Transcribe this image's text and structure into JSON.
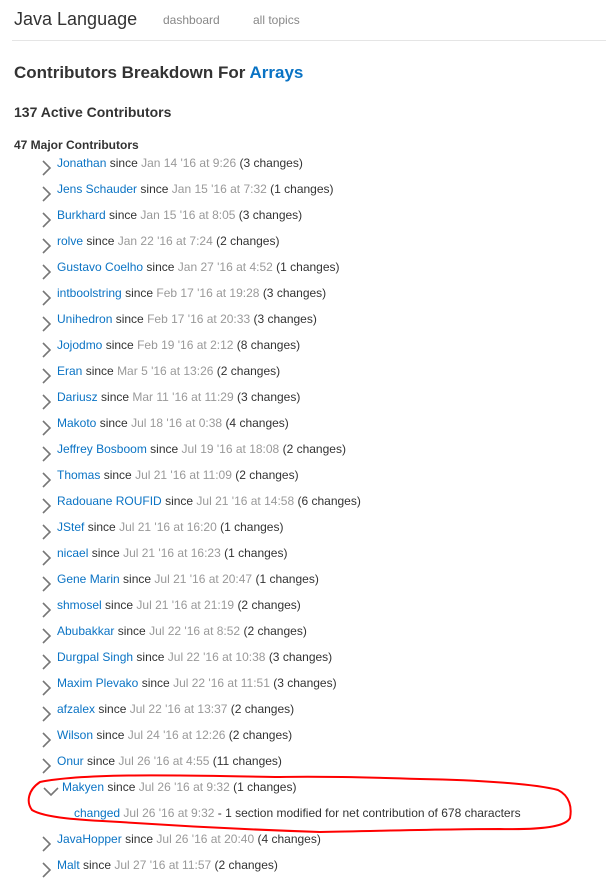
{
  "header": {
    "brand": "Java Language",
    "nav": [
      {
        "label": "dashboard"
      },
      {
        "label": "all topics"
      }
    ]
  },
  "page": {
    "title_prefix": "Contributors Breakdown For",
    "topic": "Arrays",
    "active_contributors": "137 Active Contributors",
    "major_contributors": "47 Major Contributors"
  },
  "labels": {
    "since": "since",
    "changed": "changed"
  },
  "colors": {
    "link": "#0a73c4",
    "muted": "#999999",
    "text": "#333333",
    "annotation": "#ff0000"
  },
  "contributors": [
    {
      "name": "Jonathan",
      "date": "Jan 14 '16 at 9:26",
      "changes": "(3 changes)",
      "expanded": false
    },
    {
      "name": "Jens Schauder",
      "date": "Jan 15 '16 at 7:32",
      "changes": "(1 changes)",
      "expanded": false
    },
    {
      "name": "Burkhard",
      "date": "Jan 15 '16 at 8:05",
      "changes": "(3 changes)",
      "expanded": false
    },
    {
      "name": "rolve",
      "date": "Jan 22 '16 at 7:24",
      "changes": "(2 changes)",
      "expanded": false
    },
    {
      "name": "Gustavo Coelho",
      "date": "Jan 27 '16 at 4:52",
      "changes": "(1 changes)",
      "expanded": false
    },
    {
      "name": "intboolstring",
      "date": "Feb 17 '16 at 19:28",
      "changes": "(3 changes)",
      "expanded": false
    },
    {
      "name": "Unihedron",
      "date": "Feb 17 '16 at 20:33",
      "changes": "(3 changes)",
      "expanded": false
    },
    {
      "name": "Jojodmo",
      "date": "Feb 19 '16 at 2:12",
      "changes": "(8 changes)",
      "expanded": false
    },
    {
      "name": "Eran",
      "date": "Mar 5 '16 at 13:26",
      "changes": "(2 changes)",
      "expanded": false
    },
    {
      "name": "Dariusz",
      "date": "Mar 11 '16 at 11:29",
      "changes": "(3 changes)",
      "expanded": false
    },
    {
      "name": "Makoto",
      "date": "Jul 18 '16 at 0:38",
      "changes": "(4 changes)",
      "expanded": false
    },
    {
      "name": "Jeffrey Bosboom",
      "date": "Jul 19 '16 at 18:08",
      "changes": "(2 changes)",
      "expanded": false
    },
    {
      "name": "Thomas",
      "date": "Jul 21 '16 at 11:09",
      "changes": "(2 changes)",
      "expanded": false
    },
    {
      "name": "Radouane ROUFID",
      "date": "Jul 21 '16 at 14:58",
      "changes": "(6 changes)",
      "expanded": false
    },
    {
      "name": "JStef",
      "date": "Jul 21 '16 at 16:20",
      "changes": "(1 changes)",
      "expanded": false
    },
    {
      "name": "nicael",
      "date": "Jul 21 '16 at 16:23",
      "changes": "(1 changes)",
      "expanded": false
    },
    {
      "name": "Gene Marin",
      "date": "Jul 21 '16 at 20:47",
      "changes": "(1 changes)",
      "expanded": false
    },
    {
      "name": "shmosel",
      "date": "Jul 21 '16 at 21:19",
      "changes": "(2 changes)",
      "expanded": false
    },
    {
      "name": "Abubakkar",
      "date": "Jul 22 '16 at 8:52",
      "changes": "(2 changes)",
      "expanded": false
    },
    {
      "name": "Durgpal Singh",
      "date": "Jul 22 '16 at 10:38",
      "changes": "(3 changes)",
      "expanded": false
    },
    {
      "name": "Maxim Plevako",
      "date": "Jul 22 '16 at 11:51",
      "changes": "(3 changes)",
      "expanded": false
    },
    {
      "name": "afzalex",
      "date": "Jul 22 '16 at 13:37",
      "changes": "(2 changes)",
      "expanded": false
    },
    {
      "name": "Wilson",
      "date": "Jul 24 '16 at 12:26",
      "changes": "(2 changes)",
      "expanded": false
    },
    {
      "name": "Onur",
      "date": "Jul 26 '16 at 4:55",
      "changes": "(11 changes)",
      "expanded": false
    },
    {
      "name": "Makyen",
      "date": "Jul 26 '16 at 9:32",
      "changes": "(1 changes)",
      "expanded": true,
      "details": [
        {
          "date": "Jul 26 '16 at 9:32",
          "description": "- 1 section modified for net contribution of 678 characters"
        }
      ]
    },
    {
      "name": "JavaHopper",
      "date": "Jul 26 '16 at 20:40",
      "changes": "(4 changes)",
      "expanded": false
    },
    {
      "name": "Malt",
      "date": "Jul 27 '16 at 11:57",
      "changes": "(2 changes)",
      "expanded": false
    }
  ]
}
